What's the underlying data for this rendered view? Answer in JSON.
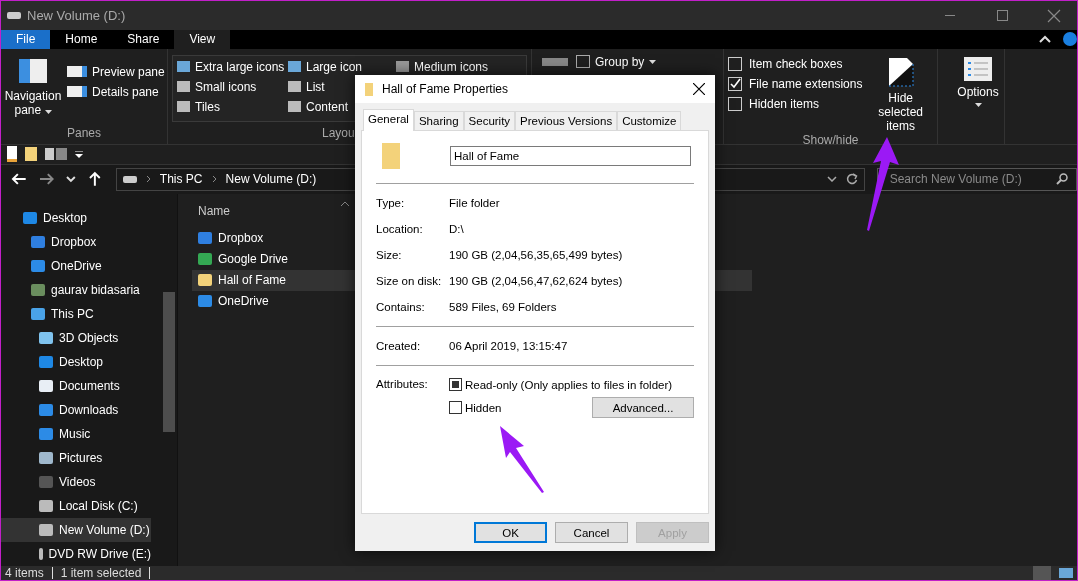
{
  "window": {
    "title": "New Volume (D:)"
  },
  "ribbon_tabs": [
    {
      "label": "File",
      "kind": "file",
      "selected": false
    },
    {
      "label": "Home",
      "kind": "tab",
      "selected": false
    },
    {
      "label": "Share",
      "kind": "tab",
      "selected": false
    },
    {
      "label": "View",
      "kind": "tab",
      "selected": true
    }
  ],
  "panes": {
    "navigation_pane": "Navigation pane",
    "items": [
      "Preview pane",
      "Details pane"
    ],
    "label": "Panes"
  },
  "layout": {
    "rows": [
      [
        {
          "label": "Extra large icons",
          "kind": "xl"
        },
        {
          "label": "Large icon",
          "kind": "lg"
        },
        {
          "label": "Medium icons",
          "kind": "md"
        }
      ],
      [
        {
          "label": "Small icons",
          "kind": "sm"
        },
        {
          "label": "List",
          "kind": "list"
        }
      ],
      [
        {
          "label": "Tiles",
          "kind": "tiles"
        },
        {
          "label": "Content",
          "kind": "content"
        }
      ]
    ],
    "label": "Layou"
  },
  "current_view": {
    "group_by": "Group by"
  },
  "show_hide": {
    "checkboxes": [
      {
        "label": "Item check boxes",
        "checked": false
      },
      {
        "label": "File name extensions",
        "checked": true
      },
      {
        "label": "Hidden items",
        "checked": false
      }
    ],
    "hide_selected": "Hide selected items",
    "label": "Show/hide"
  },
  "options": "Options",
  "address": {
    "crumbs": [
      "This PC",
      "New Volume (D:)"
    ],
    "search_placeholder": "Search New Volume (D:)"
  },
  "nav_tree": [
    {
      "label": "Desktop",
      "kind": "desktop",
      "selected": false,
      "children": [
        {
          "label": "Dropbox",
          "kind": "dropbox",
          "selected": false
        },
        {
          "label": "OneDrive",
          "kind": "cloud",
          "selected": false
        },
        {
          "label": "gaurav bidasaria",
          "kind": "user",
          "selected": false
        },
        {
          "label": "This PC",
          "kind": "pc",
          "selected": false,
          "children": [
            {
              "label": "3D Objects",
              "kind": "cube",
              "selected": false
            },
            {
              "label": "Desktop",
              "kind": "desktop",
              "selected": false
            },
            {
              "label": "Documents",
              "kind": "doc",
              "selected": false
            },
            {
              "label": "Downloads",
              "kind": "download",
              "selected": false
            },
            {
              "label": "Music",
              "kind": "music",
              "selected": false
            },
            {
              "label": "Pictures",
              "kind": "picture",
              "selected": false
            },
            {
              "label": "Videos",
              "kind": "video",
              "selected": false
            },
            {
              "label": "Local Disk (C:)",
              "kind": "drive",
              "selected": false
            },
            {
              "label": "New Volume (D:)",
              "kind": "drive",
              "selected": true
            },
            {
              "label": "DVD RW Drive (E:)",
              "kind": "dvd",
              "selected": false
            }
          ]
        }
      ]
    }
  ],
  "file_list": {
    "column": "Name",
    "files": [
      {
        "name": "Dropbox",
        "kind": "dropbox",
        "selected": false
      },
      {
        "name": "Google Drive",
        "kind": "gdrive",
        "selected": false
      },
      {
        "name": "Hall of Fame",
        "kind": "folder",
        "selected": true
      },
      {
        "name": "OneDrive",
        "kind": "cloud",
        "selected": false
      }
    ]
  },
  "status_bar": {
    "count": "4 items",
    "selection": "1 item selected"
  },
  "dialog": {
    "title": "Hall of Fame Properties",
    "tabs": [
      {
        "label": "General",
        "selected": true
      },
      {
        "label": "Sharing",
        "selected": false
      },
      {
        "label": "Security",
        "selected": false
      },
      {
        "label": "Previous Versions",
        "selected": false
      },
      {
        "label": "Customize",
        "selected": false
      }
    ],
    "name": "Hall of Fame",
    "sections": [
      [
        {
          "label": "Type:",
          "value": "File folder"
        },
        {
          "label": "Location:",
          "value": "D:\\"
        },
        {
          "label": "Size:",
          "value": "190 GB (2,04,56,35,65,499 bytes)"
        },
        {
          "label": "Size on disk:",
          "value": "190 GB (2,04,56,47,62,624 bytes)"
        },
        {
          "label": "Contains:",
          "value": "589 Files, 69 Folders"
        }
      ],
      [
        {
          "label": "Created:",
          "value": "06 April 2019, 13:15:47"
        }
      ]
    ],
    "attributes_label": "Attributes:",
    "attributes": [
      {
        "label": "Read-only (Only applies to files in folder)",
        "checked": false,
        "indeterminate": true
      },
      {
        "label": "Hidden",
        "checked": false,
        "indeterminate": false
      }
    ],
    "advanced": "Advanced...",
    "buttons": [
      {
        "label": "OK",
        "kind": "default",
        "disabled": false
      },
      {
        "label": "Cancel",
        "kind": "normal",
        "disabled": false
      },
      {
        "label": "Apply",
        "kind": "normal",
        "disabled": true
      }
    ]
  }
}
